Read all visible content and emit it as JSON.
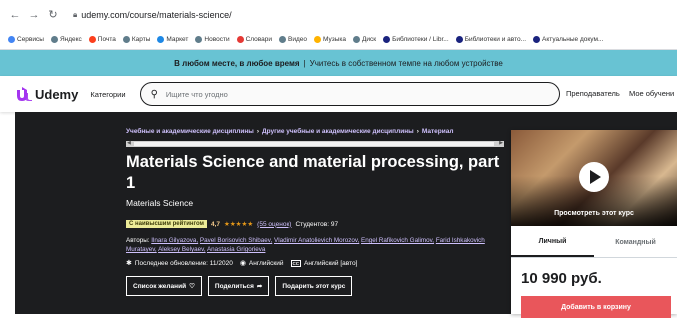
{
  "browser": {
    "url": "udemy.com/course/materials-science/",
    "bookmarks": [
      {
        "label": "Сервисы",
        "color": "#4285f4"
      },
      {
        "label": "Яндекс",
        "color": "#607d8b"
      },
      {
        "label": "Почта",
        "color": "#fc3f1d"
      },
      {
        "label": "Карты",
        "color": "#607d8b"
      },
      {
        "label": "Маркет",
        "color": "#1e88e5"
      },
      {
        "label": "Новости",
        "color": "#607d8b"
      },
      {
        "label": "Словари",
        "color": "#e53935"
      },
      {
        "label": "Видео",
        "color": "#607d8b"
      },
      {
        "label": "Музыка",
        "color": "#ffb300"
      },
      {
        "label": "Диск",
        "color": "#607d8b"
      },
      {
        "label": "Библиотеки / Libr...",
        "color": "#1a237e"
      },
      {
        "label": "Библиотеки и авто...",
        "color": "#1a237e"
      },
      {
        "label": "Актуальные докум...",
        "color": "#1a237e"
      }
    ]
  },
  "banner": {
    "bold": "В любом месте, в любое время",
    "separator": "|",
    "text": "Учитесь в собственном темпе на любом устройстве"
  },
  "header": {
    "logo": "Udemy",
    "categories": "Категории",
    "search_placeholder": "Ищите что угодно",
    "teacher": "Преподаватель",
    "my_learning": "Мое обучени"
  },
  "course": {
    "breadcrumbs": [
      "Учебные и академические дисциплины",
      "Другие учебные и академические дисциплины",
      "Материал"
    ],
    "title": "Materials Science and material processing, part 1",
    "subtitle": "Materials Science",
    "badge": "С наивысшим рейтингом",
    "rating": "4,7",
    "stars": "★★★★★",
    "reviews": "(55 оценок)",
    "students": "Студентов: 97",
    "authors_label": "Авторы:",
    "authors": [
      "Ilnara Gilyazova,",
      "Pavel Borisovich Shibaev,",
      "Vladimir Anatolievich Morozov,",
      "Engel Rafikovich Galimov,",
      "Farid Ishkakovich Muratayev,",
      "Aleksey Belyaev,",
      "Anastasia Grigorieva"
    ],
    "updated": "Последнее обновление: 11/2020",
    "language": "Английский",
    "captions": "Английский [авто]",
    "cc": "CC",
    "wishlist": "Список желаний",
    "share": "Поделиться",
    "gift": "Подарить этот курс"
  },
  "sidebar": {
    "preview": "Просмотреть этот курс",
    "tab_personal": "Личный",
    "tab_team": "Командный",
    "price": "10 990 руб.",
    "cart": "Добавить в корзину"
  }
}
